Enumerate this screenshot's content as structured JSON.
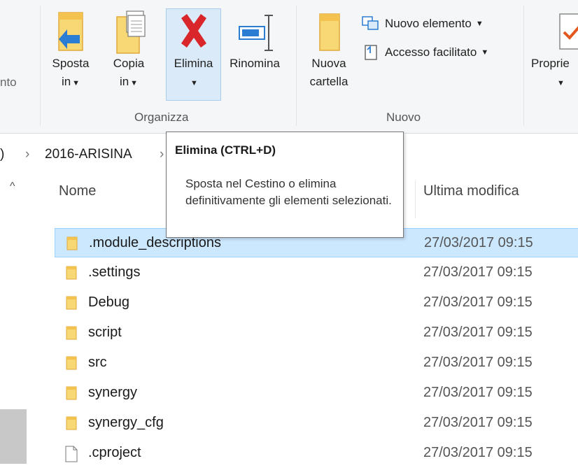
{
  "ribbon": {
    "cut_left_label": "nto",
    "sposta": {
      "line1": "Sposta",
      "line2": "in"
    },
    "copia": {
      "line1": "Copia",
      "line2": "in"
    },
    "elimina": {
      "label": "Elimina"
    },
    "rinomina": {
      "label": "Rinomina"
    },
    "nuova_cartella": {
      "line1": "Nuova",
      "line2": "cartella"
    },
    "nuovo_elemento": "Nuovo elemento",
    "accesso_facilitato": "Accesso facilitato",
    "proprieta": "Proprie",
    "groups": {
      "organizza": "Organizza",
      "nuovo": "Nuovo"
    },
    "caret": "▼"
  },
  "address": {
    "left_fragment": ")",
    "separator": "›",
    "folder": "2016-ARISINA",
    "separator2": "›"
  },
  "columns": {
    "name": "Nome",
    "modified": "Ultima modifica"
  },
  "files": [
    {
      "name": ".module_descriptions",
      "date": "27/03/2017 09:15",
      "type": "folder",
      "selected": true
    },
    {
      "name": ".settings",
      "date": "27/03/2017 09:15",
      "type": "folder",
      "selected": false
    },
    {
      "name": "Debug",
      "date": "27/03/2017 09:15",
      "type": "folder",
      "selected": false
    },
    {
      "name": "script",
      "date": "27/03/2017 09:15",
      "type": "folder",
      "selected": false
    },
    {
      "name": "src",
      "date": "27/03/2017 09:15",
      "type": "folder",
      "selected": false
    },
    {
      "name": "synergy",
      "date": "27/03/2017 09:15",
      "type": "folder",
      "selected": false
    },
    {
      "name": "synergy_cfg",
      "date": "27/03/2017 09:15",
      "type": "folder",
      "selected": false
    },
    {
      "name": ".cproject",
      "date": "27/03/2017 09:15",
      "type": "file",
      "selected": false
    }
  ],
  "tooltip": {
    "title": "Elimina (CTRL+D)",
    "body": "Sposta nel Cestino o elimina definitivamente gli elementi selezionati."
  },
  "colors": {
    "folder": "#f8d775",
    "folder_dark": "#e0a93a",
    "delete_red": "#d9262b",
    "selection": "#cce8ff",
    "accent_blue": "#2b7cd3"
  }
}
